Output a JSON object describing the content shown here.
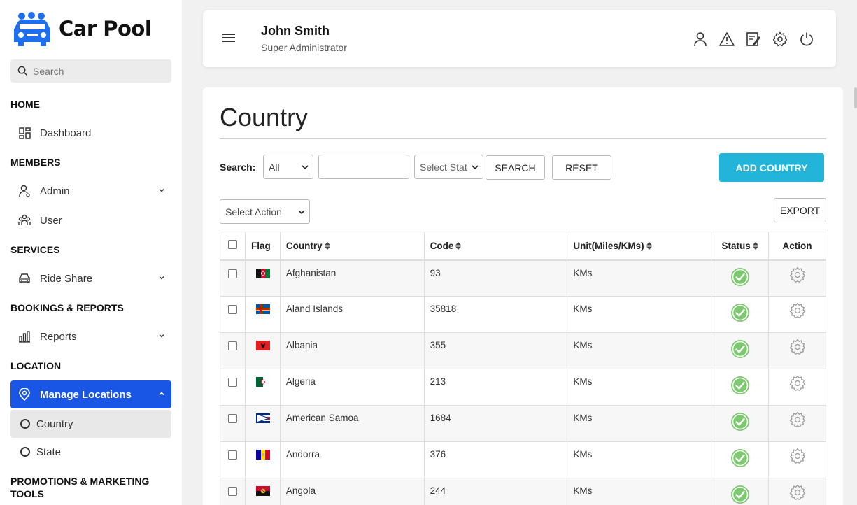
{
  "app": {
    "name": "Car Pool"
  },
  "sidebar": {
    "search_placeholder": "Search",
    "sections": {
      "home": "HOME",
      "members": "MEMBERS",
      "services": "SERVICES",
      "bookings": "BOOKINGS & REPORTS",
      "location": "LOCATION",
      "promotions": "PROMOTIONS & MARKETING TOOLS"
    },
    "items": {
      "dashboard": "Dashboard",
      "admin": "Admin",
      "user": "User",
      "ride_share": "Ride Share",
      "reports": "Reports",
      "manage_locations": "Manage Locations",
      "country": "Country",
      "state": "State"
    }
  },
  "header": {
    "user_name": "John Smith",
    "user_role": "Super Administrator",
    "icons": [
      "profile-icon",
      "alert-icon",
      "edit-icon",
      "settings-icon",
      "power-icon"
    ]
  },
  "page": {
    "title": "Country",
    "search_label": "Search:",
    "filter_all": "All",
    "search_value": "",
    "status_select": "Select Stat",
    "search_button": "SEARCH",
    "reset_button": "RESET",
    "add_button": "ADD COUNTRY",
    "action_select": "Select Action",
    "export_button": "EXPORT"
  },
  "table": {
    "headers": {
      "flag": "Flag",
      "country": "Country",
      "code": "Code",
      "unit": "Unit(Miles/KMs)",
      "status": "Status",
      "action": "Action"
    },
    "rows": [
      {
        "country": "Afghanistan",
        "code": "93",
        "unit": "KMs",
        "flag": "af"
      },
      {
        "country": "Aland Islands",
        "code": "35818",
        "unit": "KMs",
        "flag": "ax"
      },
      {
        "country": "Albania",
        "code": "355",
        "unit": "KMs",
        "flag": "al"
      },
      {
        "country": "Algeria",
        "code": "213",
        "unit": "KMs",
        "flag": "dz"
      },
      {
        "country": "American Samoa",
        "code": "1684",
        "unit": "KMs",
        "flag": "as"
      },
      {
        "country": "Andorra",
        "code": "376",
        "unit": "KMs",
        "flag": "ad"
      },
      {
        "country": "Angola",
        "code": "244",
        "unit": "KMs",
        "flag": "ao"
      }
    ]
  },
  "colors": {
    "accent": "#1a56e6",
    "primary_button": "#22b5d9",
    "status_green": "#7cc86e",
    "brand_blue": "#1e6ff0"
  }
}
